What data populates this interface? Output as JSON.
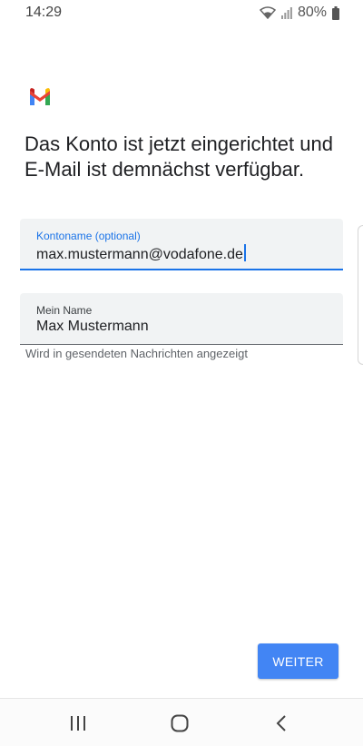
{
  "status_bar": {
    "time": "14:29",
    "battery_percent": "80%",
    "icons": [
      "wifi-icon",
      "signal-icon",
      "battery-icon"
    ]
  },
  "app": {
    "logo": "gmail-logo",
    "colors": {
      "accent": "#1a73e8",
      "button": "#4285f4"
    }
  },
  "content": {
    "headline": "Das Konto ist jetzt eingerichtet und E-Mail ist demnächst verfügbar.",
    "account_field": {
      "label": "Kontoname (optional)",
      "value": "max.mustermann@vodafone.de"
    },
    "name_field": {
      "label": "Mein Name",
      "value": "Max Mustermann",
      "helper": "Wird in gesendeten Nachrichten angezeigt"
    }
  },
  "actions": {
    "next_label": "WEITER"
  },
  "navigation": {
    "buttons": [
      "recents-icon",
      "home-icon",
      "back-icon"
    ]
  }
}
